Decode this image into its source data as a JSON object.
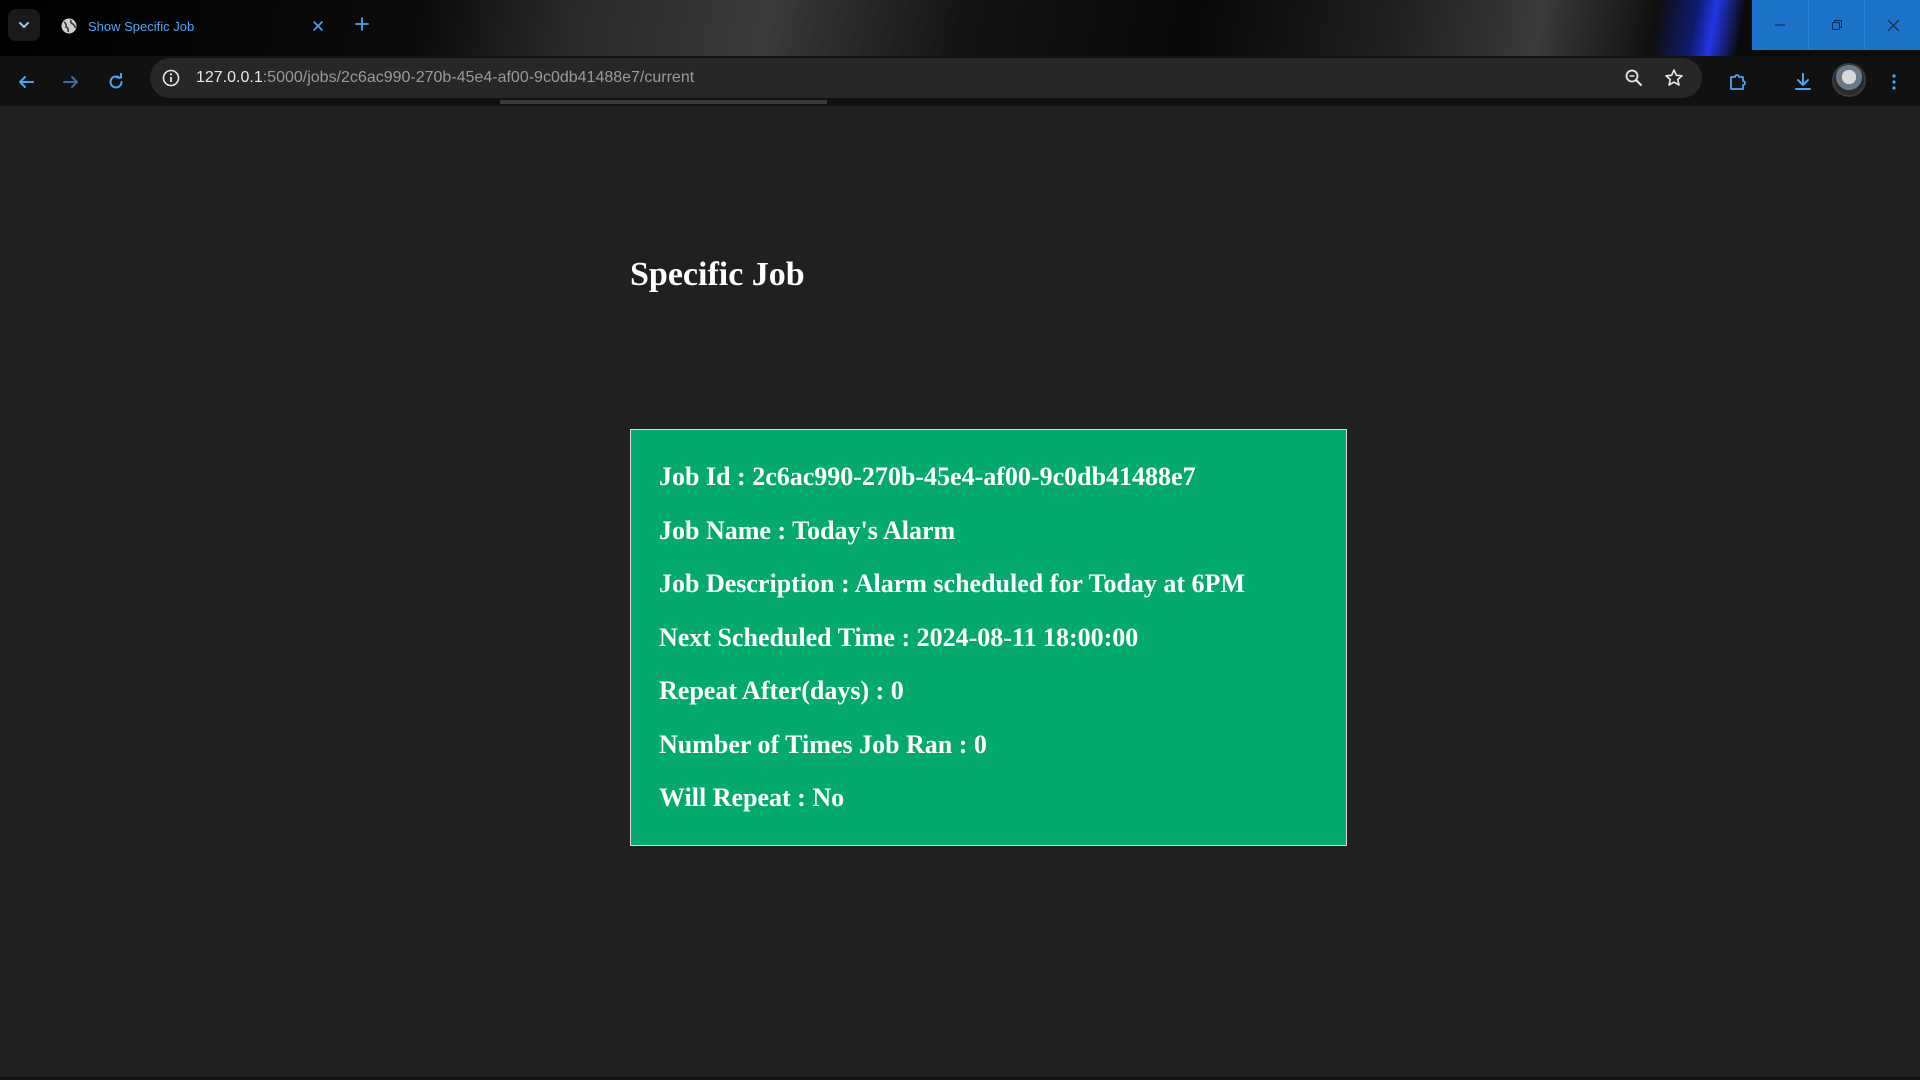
{
  "browser": {
    "tab": {
      "title": "Show Specific Job",
      "favicon": "globe-icon"
    },
    "address_bar": {
      "host": "127.0.0.1",
      "path": ":5000/jobs/2c6ac990-270b-45e4-af00-9c0db41488e7/current"
    },
    "icons": {
      "tab_list": "chevron-down-icon",
      "new_tab": "plus-icon",
      "back": "arrow-left-icon",
      "forward": "arrow-right-icon",
      "reload": "reload-icon",
      "site_info": "info-icon",
      "zoom": "zoom-icon",
      "bookmark": "star-icon",
      "extensions": "puzzle-icon",
      "downloads": "download-icon",
      "menu": "kebab-menu-icon"
    },
    "accent_color": "#4ea4f4"
  },
  "page": {
    "heading": "Specific Job",
    "card_color": "#04aa6d",
    "job": {
      "id": "Job Id : 2c6ac990-270b-45e4-af00-9c0db41488e7",
      "name": "Job Name : Today's Alarm",
      "description": "Job Description : Alarm scheduled for Today at 6PM",
      "next_time": "Next Scheduled Time : 2024-08-11 18:00:00",
      "repeat_after": "Repeat After(days) : 0",
      "times_ran": "Number of Times Job Ran : 0",
      "will_repeat": "Will Repeat : No"
    }
  }
}
